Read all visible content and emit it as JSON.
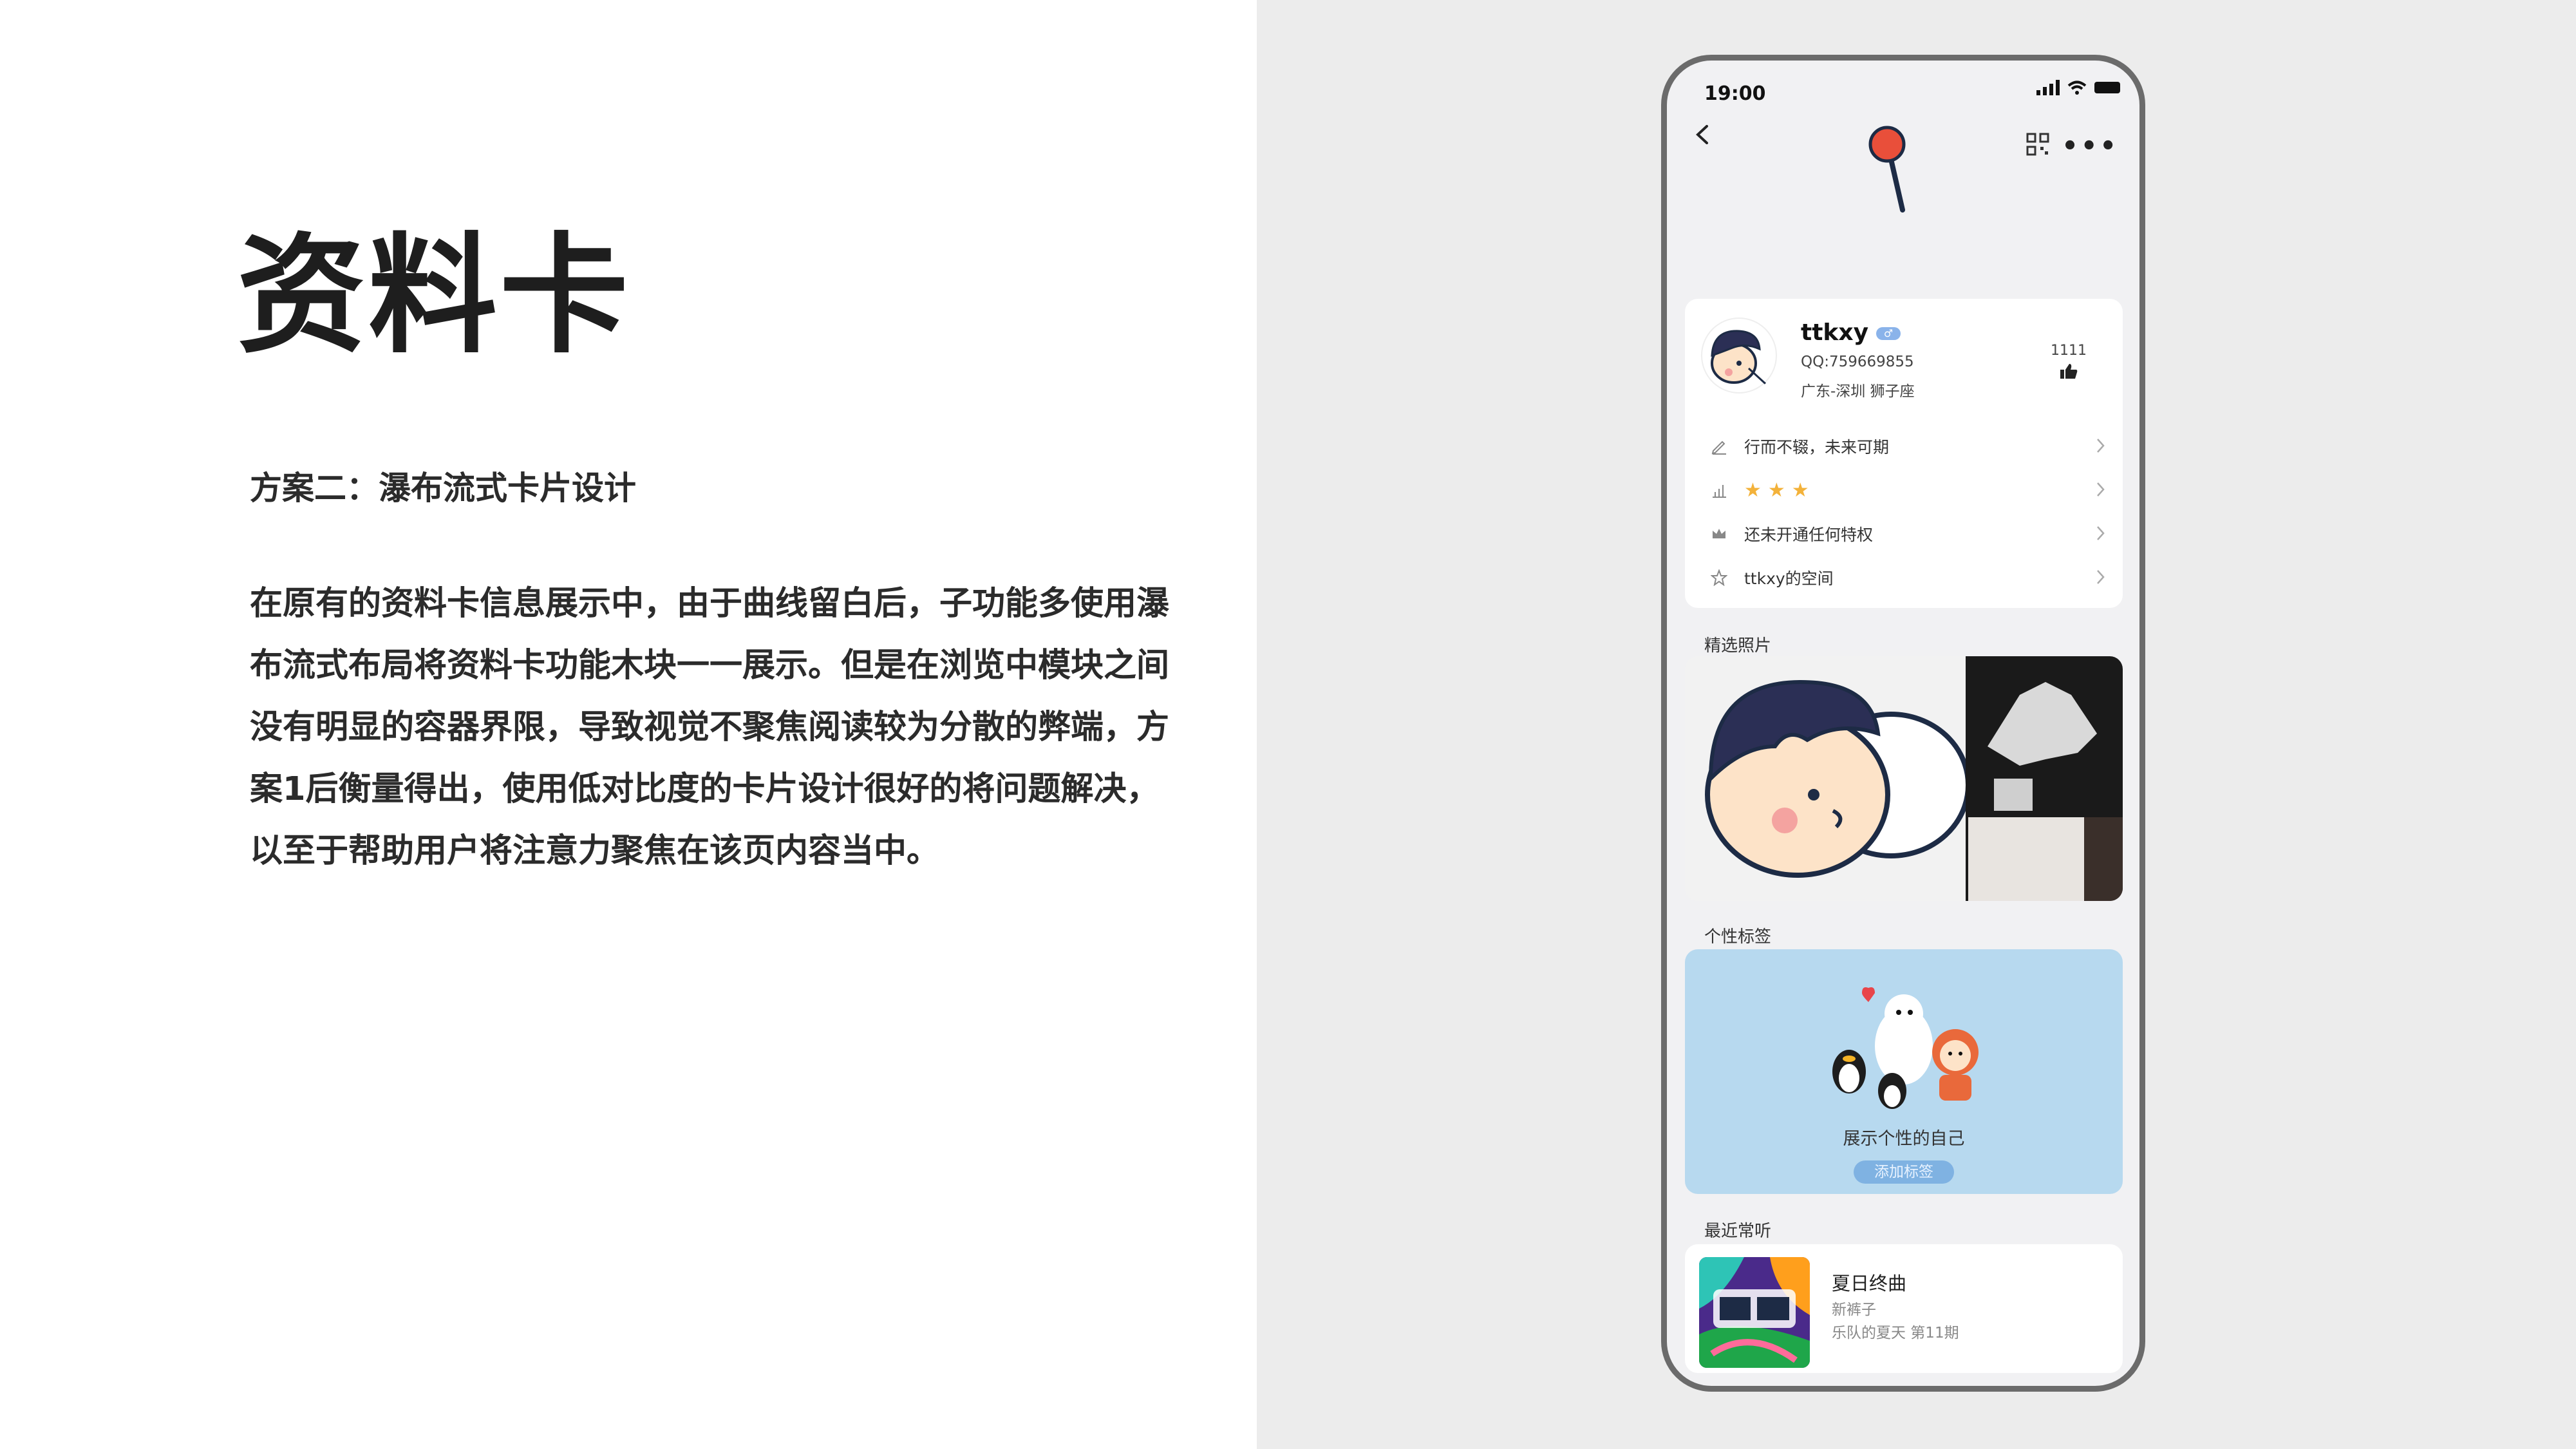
{
  "slide": {
    "title": "资料卡",
    "subtitle": "方案二：瀑布流式卡片设计",
    "description_lines": [
      "在原有的资料卡信息展示中，由于曲线留白后，子功能多使用瀑",
      "布流式布局将资料卡功能木块一一展示。但是在浏览中模块之间",
      "没有明显的容器界限，导致视觉不聚焦阅读较为分散的弊端，方",
      "案1后衡量得出，使用低对比度的卡片设计很好的将问题解决，",
      "以至于帮助用户将注意力聚焦在该页内容当中。"
    ]
  },
  "phone": {
    "status_time": "19:00",
    "profile": {
      "username": "ttkxy",
      "gender_badge": "♂",
      "qq": "QQ:759669855",
      "location": "广东-深圳    狮子座",
      "likes": "1111"
    },
    "rows": [
      {
        "icon": "pencil-icon",
        "text": "行而不辍，未来可期"
      },
      {
        "icon": "level-chart-icon",
        "text": "★★★"
      },
      {
        "icon": "crown-icon",
        "text": "还未开通任何特权"
      },
      {
        "icon": "star-outline-icon",
        "text": "ttkxy的空间"
      }
    ],
    "photos_label": "精选照片",
    "tags_label": "个性标签",
    "tags_text": "展示个性的自己",
    "tags_button": "添加标签",
    "music_label": "最近常听",
    "music": {
      "song": "夏日终曲",
      "artist": "新裤子",
      "album": "乐队的夏天 第11期"
    }
  },
  "colors": {
    "right_bg": "#ececec",
    "phone_frame": "#6b6b6b",
    "tags_bg": "#b7d9ef",
    "tag_button": "#7fb2e2",
    "star": "#f3b23a",
    "gender_badge": "#8ab3ea"
  }
}
